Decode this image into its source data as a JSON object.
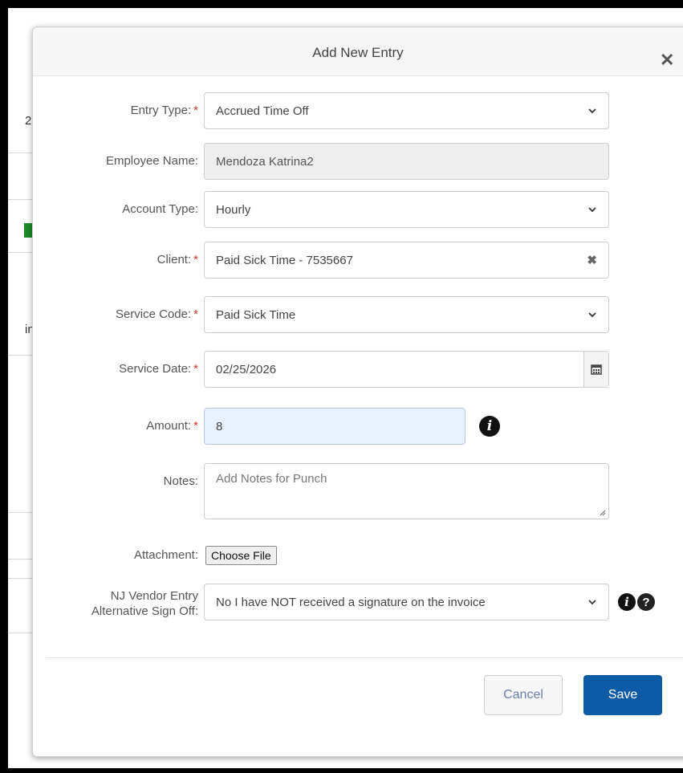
{
  "background": {
    "partial_text_1": "2",
    "partial_text_2": "in",
    "accent_color": "#1d8a2a"
  },
  "modal": {
    "title": "Add New Entry",
    "close_icon": "close-icon"
  },
  "form": {
    "entry_type": {
      "label": "Entry Type:",
      "required_mark": "*",
      "value": "Accrued Time Off"
    },
    "employee_name": {
      "label": "Employee Name:",
      "value": "Mendoza Katrina2"
    },
    "account_type": {
      "label": "Account Type:",
      "value": "Hourly"
    },
    "client": {
      "label": "Client:",
      "required_mark": "*",
      "value": "Paid Sick Time - 7535667",
      "clear_icon": "clear-x-icon"
    },
    "service_code": {
      "label": "Service Code:",
      "required_mark": "*",
      "value": "Paid Sick Time"
    },
    "service_date": {
      "label": "Service Date:",
      "required_mark": "*",
      "value": "02/25/2026",
      "icon": "calendar-icon"
    },
    "amount": {
      "label": "Amount:",
      "required_mark": "*",
      "value": "8",
      "icon": "info-icon"
    },
    "notes": {
      "label": "Notes:",
      "placeholder": "Add Notes for Punch"
    },
    "attachment": {
      "label": "Attachment:",
      "button_label": "Choose File"
    },
    "nj_vendor": {
      "label_line1": "NJ Vendor Entry",
      "label_line2": "Alternative Sign Off:",
      "value": "No I have NOT received a signature on the invoice",
      "icons": [
        "info-icon",
        "question-icon"
      ]
    }
  },
  "footer": {
    "cancel_label": "Cancel",
    "save_label": "Save",
    "save_color": "#0d5aa7"
  }
}
